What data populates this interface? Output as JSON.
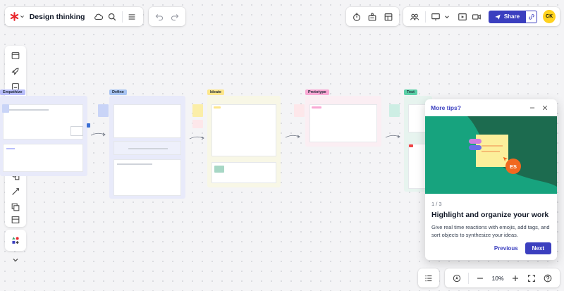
{
  "header": {
    "doc_title": "Design thinking",
    "share_label": "Share",
    "avatar_initials": "CK"
  },
  "frames": [
    {
      "tag": "Empathize"
    },
    {
      "tag": "Define"
    },
    {
      "tag": "Ideate"
    },
    {
      "tag": "Prototype"
    },
    {
      "tag": "Test"
    }
  ],
  "zoom": {
    "level": "10%"
  },
  "tips": {
    "title": "More tips?",
    "step": "1 / 3",
    "heading": "Highlight and organize your work",
    "body": "Give real time reactions with emojis, add tags, and sort objects to synthesize your ideas.",
    "avatar_initials": "ES",
    "prev_label": "Previous",
    "next_label": "Next"
  },
  "colors": {
    "accent": "#3b3fbf",
    "logo": "#e8292f",
    "avatar_bg": "#ffd21f",
    "illus_bg": "#1c6b4f",
    "illus_wave": "#17a37e"
  }
}
